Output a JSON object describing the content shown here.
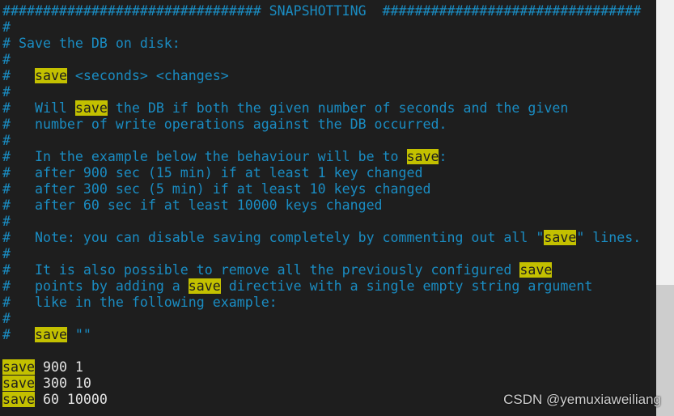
{
  "colors": {
    "background": "#1e1e1e",
    "comment": "#1a8cc2",
    "plain": "#e4e4e4",
    "search_highlight": "#c3c000"
  },
  "editor": {
    "lines": [
      [
        {
          "t": "################################ SNAPSHOTTING  ################################",
          "c": "comment"
        }
      ],
      [
        {
          "t": "#",
          "c": "comment"
        }
      ],
      [
        {
          "t": "# Save the DB on disk:",
          "c": "comment"
        }
      ],
      [
        {
          "t": "#",
          "c": "comment"
        }
      ],
      [
        {
          "t": "#   ",
          "c": "comment"
        },
        {
          "t": "save",
          "c": "hl"
        },
        {
          "t": " <seconds> <changes>",
          "c": "comment"
        }
      ],
      [
        {
          "t": "#",
          "c": "comment"
        }
      ],
      [
        {
          "t": "#   Will ",
          "c": "comment"
        },
        {
          "t": "save",
          "c": "hl"
        },
        {
          "t": " the DB if both the given number of seconds and the given",
          "c": "comment"
        }
      ],
      [
        {
          "t": "#   number of write operations against the DB occurred.",
          "c": "comment"
        }
      ],
      [
        {
          "t": "#",
          "c": "comment"
        }
      ],
      [
        {
          "t": "#   In the example below the behaviour will be to ",
          "c": "comment"
        },
        {
          "t": "save",
          "c": "hl"
        },
        {
          "t": ":",
          "c": "comment"
        }
      ],
      [
        {
          "t": "#   after 900 sec (15 min) if at least 1 key changed",
          "c": "comment"
        }
      ],
      [
        {
          "t": "#   after 300 sec (5 min) if at least 10 keys changed",
          "c": "comment"
        }
      ],
      [
        {
          "t": "#   after 60 sec if at least 10000 keys changed",
          "c": "comment"
        }
      ],
      [
        {
          "t": "#",
          "c": "comment"
        }
      ],
      [
        {
          "t": "#   Note: you can disable saving completely by commenting out all \"",
          "c": "comment"
        },
        {
          "t": "save",
          "c": "hl"
        },
        {
          "t": "\" lines.",
          "c": "comment"
        }
      ],
      [
        {
          "t": "#",
          "c": "comment"
        }
      ],
      [
        {
          "t": "#   It is also possible to remove all the previously configured ",
          "c": "comment"
        },
        {
          "t": "save",
          "c": "hl"
        }
      ],
      [
        {
          "t": "#   points by adding a ",
          "c": "comment"
        },
        {
          "t": "save",
          "c": "hl"
        },
        {
          "t": " directive with a single empty string argument",
          "c": "comment"
        }
      ],
      [
        {
          "t": "#   like in the following example:",
          "c": "comment"
        }
      ],
      [
        {
          "t": "#",
          "c": "comment"
        }
      ],
      [
        {
          "t": "#   ",
          "c": "comment"
        },
        {
          "t": "save",
          "c": "hl"
        },
        {
          "t": " \"\"",
          "c": "comment"
        }
      ],
      [],
      [
        {
          "t": "save",
          "c": "hl"
        },
        {
          "t": " 900 1",
          "c": "plain"
        }
      ],
      [
        {
          "t": "save",
          "c": "hl"
        },
        {
          "t": " 300 10",
          "c": "plain"
        }
      ],
      [
        {
          "t": "save",
          "c": "hl"
        },
        {
          "t": " 60 10000",
          "c": "plain"
        }
      ]
    ]
  },
  "watermark": "CSDN @yemuxiaweiliang"
}
